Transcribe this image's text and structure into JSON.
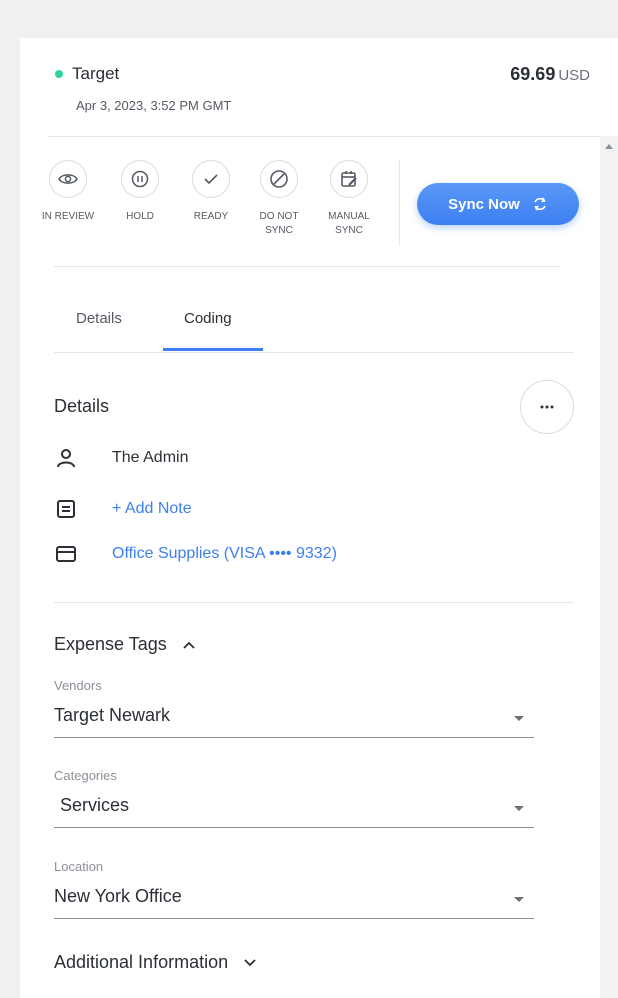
{
  "header": {
    "merchant": "Target",
    "date": "Apr 3, 2023, 3:52 PM GMT",
    "amount": "69.69",
    "currency": "USD",
    "status_color": "#2fd49a"
  },
  "status_buttons": [
    {
      "label": "IN REVIEW",
      "icon": "eye-icon"
    },
    {
      "label": "HOLD",
      "icon": "pause-icon"
    },
    {
      "label": "READY",
      "icon": "check-icon"
    },
    {
      "label": "DO NOT SYNC",
      "icon": "block-icon"
    },
    {
      "label": "MANUAL SYNC",
      "icon": "calendar-edit-icon"
    }
  ],
  "sync_button": {
    "label": "Sync Now",
    "icon": "refresh-icon",
    "color": "#3c7ff2"
  },
  "tabs": [
    {
      "label": "Details",
      "active": false
    },
    {
      "label": "Coding",
      "active": true
    }
  ],
  "details": {
    "title": "Details",
    "more_icon": "more-horizontal-icon",
    "user": "The Admin",
    "add_note": "+ Add Note",
    "card": "Office Supplies (VISA •••• 9332)"
  },
  "expense_tags": {
    "title": "Expense Tags",
    "fields": [
      {
        "label": "Vendors",
        "value": "Target Newark"
      },
      {
        "label": "Categories",
        "value": "Services"
      },
      {
        "label": "Location",
        "value": "New York Office"
      }
    ]
  },
  "additional_info": {
    "title": "Additional Information"
  }
}
